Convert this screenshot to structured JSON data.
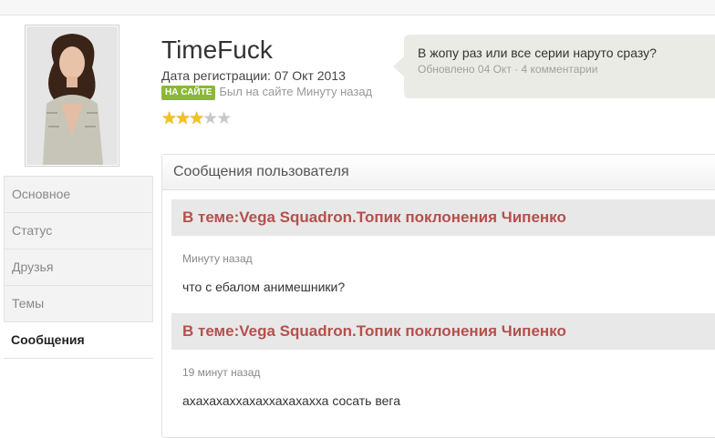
{
  "profile": {
    "username": "TimeFuck",
    "registration": "Дата регистрации: 07 Окт 2013",
    "online_badge": "НА САЙТЕ",
    "last_seen": "Был на сайте Минуту назад",
    "rating": {
      "value": 3,
      "max": 5
    }
  },
  "status": {
    "text": "В жопу раз или все серии наруто сразу?",
    "meta": "Обновлено 04 Окт · 4 комментарии"
  },
  "nav": {
    "items": [
      "Основное",
      "Статус",
      "Друзья",
      "Темы",
      "Сообщения"
    ],
    "active": "Сообщения"
  },
  "messages": {
    "header": "Сообщения пользователя",
    "items": [
      {
        "topic": "В теме:Vega Squadron.Топик поклонения Чипенко",
        "time": "Минуту назад",
        "text": "что с ебалом анимешники?"
      },
      {
        "topic": "В теме:Vega Squadron.Топик поклонения Чипенко",
        "time": "19 минут назад",
        "text": "ахахахаххахаххахахахха сосать вега"
      }
    ]
  },
  "colors": {
    "topic": "#b5504c",
    "badge": "#8bb838",
    "bubble": "#ebebe6"
  },
  "icons": {
    "star": "star-icon",
    "avatar": "avatar-image"
  }
}
